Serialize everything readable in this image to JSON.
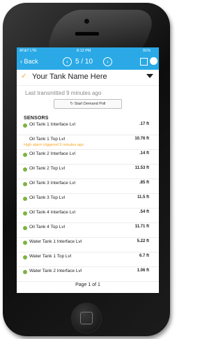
{
  "status_bar": {
    "carrier": "AT&T  LTE",
    "time": "8:12 PM",
    "battery": "91%"
  },
  "nav": {
    "back_label": "Back",
    "prev_icon": "chevron-left-circle-icon",
    "next_icon": "chevron-right-circle-icon",
    "page_counter": "5 / 10"
  },
  "tank": {
    "name": "Your Tank Name Here"
  },
  "last_transmitted": "Last transmitted 9 minutes ago",
  "poll_button": "Start Demand Poll",
  "sensors_heading": "SENSORS",
  "sensors": [
    {
      "label": "Oil Tank 1 Interface Lvl",
      "value": ".17 ft",
      "alarm": ""
    },
    {
      "label": "Oil Tank 1 Top Lvl",
      "value": "10.76 ft",
      "alarm": "High alarm triggered 9 minutes ago"
    },
    {
      "label": "Oil Tank 2 Interface Lvl",
      "value": ".14 ft",
      "alarm": ""
    },
    {
      "label": "Oil Tank 2 Top Lvl",
      "value": "11.53 ft",
      "alarm": ""
    },
    {
      "label": "Oil Tank 3 Interface Lvl",
      "value": ".85 ft",
      "alarm": ""
    },
    {
      "label": "Oil Tank 3 Top Lvl",
      "value": "11.5 ft",
      "alarm": ""
    },
    {
      "label": "Oil Tank 4 Interface Lvl",
      "value": ".54 ft",
      "alarm": ""
    },
    {
      "label": "Oil Tank 4 Top Lvl",
      "value": "11.71 ft",
      "alarm": ""
    },
    {
      "label": "Water Tank 1 Interface Lvl",
      "value": "5.22 ft",
      "alarm": ""
    },
    {
      "label": "Water Tank 1 Top Lvl",
      "value": "6.7 ft",
      "alarm": ""
    },
    {
      "label": "Water Tank 2 Interface Lvl",
      "value": "1.06 ft",
      "alarm": ""
    }
  ],
  "pagination": "Page 1 of 1",
  "colors": {
    "accent": "#2aa9e6",
    "ok": "#7cb342",
    "alarm": "#f5a623"
  }
}
